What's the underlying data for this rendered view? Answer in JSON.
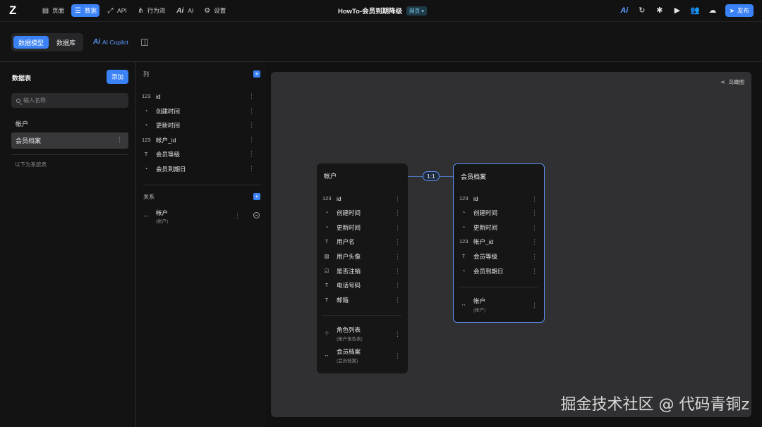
{
  "topbar": {
    "logo": "Z",
    "nav": [
      {
        "label": "页面",
        "icon": "page-icon",
        "active": false
      },
      {
        "label": "数据",
        "icon": "database-icon",
        "active": true
      },
      {
        "label": "API",
        "icon": "api-icon",
        "active": false
      },
      {
        "label": "行为流",
        "icon": "flow-icon",
        "active": false
      },
      {
        "label": "AI",
        "icon": "ai-icon",
        "active": false
      },
      {
        "label": "设置",
        "icon": "gear-icon",
        "active": false
      }
    ],
    "title": "HowTo-会员到期降级",
    "badge": "网页 ▾",
    "publish_label": "发布",
    "ai_mark": "Ai",
    "accent": "#3b82f6"
  },
  "subbar": {
    "tabs": [
      "数据模型",
      "数据库"
    ],
    "copilot_prefix": "Ai",
    "copilot_label": "AI Copilot"
  },
  "left": {
    "title": "数据表",
    "add_label": "添加",
    "search_placeholder": "输入名称",
    "tables": [
      "帐户",
      "会员档案"
    ],
    "selected_table": "会员档案",
    "more": "⋮",
    "system_label": "以下为系统表"
  },
  "columns": {
    "title": "列",
    "items": [
      {
        "name": "id",
        "icon": "id-icon"
      },
      {
        "name": "创建时间",
        "icon": "clock-icon"
      },
      {
        "name": "更新时间",
        "icon": "clock-icon"
      },
      {
        "name": "帐户_id",
        "icon": "id-icon"
      },
      {
        "name": "会员等级",
        "icon": "text-icon"
      },
      {
        "name": "会员到期日",
        "icon": "clock-icon"
      }
    ],
    "relations_title": "关系",
    "relations": [
      {
        "name": "帐户",
        "sub": "(帐户)"
      }
    ]
  },
  "canvas": {
    "birdview_label": "鸟瞰图",
    "link_label": "1:1",
    "entities": [
      {
        "title": "帐户",
        "fields": [
          {
            "name": "id",
            "icon": "id-icon"
          },
          {
            "name": "创建时间",
            "icon": "clock-icon"
          },
          {
            "name": "更新时间",
            "icon": "clock-icon"
          },
          {
            "name": "用户名",
            "icon": "text-icon"
          },
          {
            "name": "用户头像",
            "icon": "image-icon"
          },
          {
            "name": "是否注销",
            "icon": "checkbox-icon"
          },
          {
            "name": "电话号码",
            "icon": "text-icon"
          },
          {
            "name": "邮箱",
            "icon": "text-icon"
          }
        ],
        "relations": [
          {
            "name": "角色列表",
            "sub": "(帐户角色表)",
            "icon": "many-relation-icon"
          },
          {
            "name": "会员档案",
            "sub": "(会员档案)",
            "icon": "relation-icon"
          }
        ]
      },
      {
        "title": "会员档案",
        "fields": [
          {
            "name": "id",
            "icon": "id-icon"
          },
          {
            "name": "创建时间",
            "icon": "clock-icon"
          },
          {
            "name": "更新时间",
            "icon": "clock-icon"
          },
          {
            "name": "帐户_id",
            "icon": "id-icon"
          },
          {
            "name": "会员等级",
            "icon": "text-icon"
          },
          {
            "name": "会员到期日",
            "icon": "clock-icon"
          }
        ],
        "relations": [
          {
            "name": "帐户",
            "sub": "(帐户)",
            "icon": "relation-icon"
          }
        ]
      }
    ]
  },
  "watermark": "掘金技术社区 @ 代码青铜z"
}
